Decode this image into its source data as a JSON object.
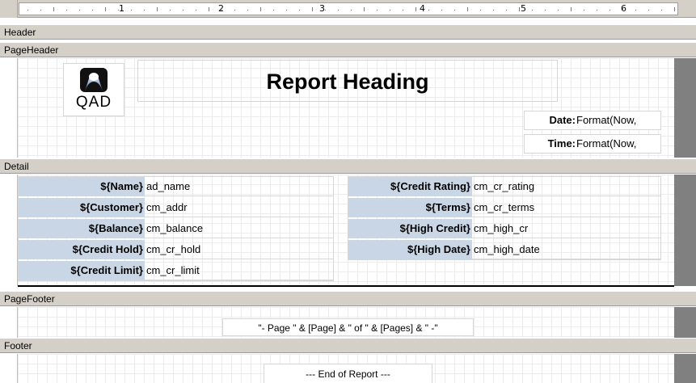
{
  "ruler": {
    "numbers": [
      "1",
      "2",
      "3",
      "4",
      "5",
      "6"
    ]
  },
  "sections": {
    "header": "Header",
    "page_header": "PageHeader",
    "detail": "Detail",
    "page_footer": "PageFooter",
    "footer": "Footer"
  },
  "logo_text": "QAD",
  "report_heading": "Report Heading",
  "date_label": "Date:",
  "date_value": "Format(Now,",
  "time_label": "Time:",
  "time_value": "Format(Now,",
  "left_fields": [
    {
      "label": "${Name}",
      "value": "ad_name"
    },
    {
      "label": "${Customer}",
      "value": "cm_addr"
    },
    {
      "label": "${Balance}",
      "value": "cm_balance"
    },
    {
      "label": "${Credit Hold}",
      "value": "cm_cr_hold"
    },
    {
      "label": "${Credit Limit}",
      "value": "cm_cr_limit"
    }
  ],
  "right_fields": [
    {
      "label": "${Credit Rating}",
      "value": "cm_cr_rating"
    },
    {
      "label": "${Terms}",
      "value": "cm_cr_terms"
    },
    {
      "label": "${High Credit}",
      "value": "cm_high_cr"
    },
    {
      "label": "${High Date}",
      "value": "cm_high_date"
    }
  ],
  "page_footer_expr": "\"- Page \" & [Page] & \" of \" & [Pages] & \" -\"",
  "end_of_report": "--- End of Report ---",
  "colors": {
    "label_bg": "#c9d6e5",
    "section_bg": "#d4d0c8",
    "gutter": "#808080"
  }
}
